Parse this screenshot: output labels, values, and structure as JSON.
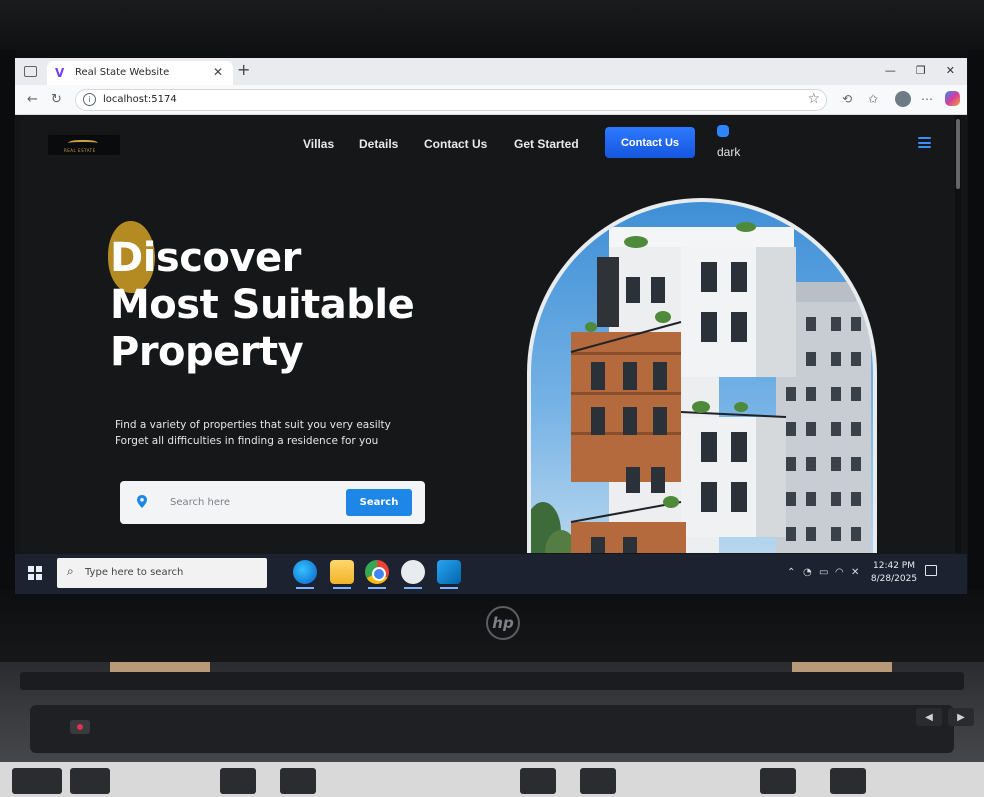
{
  "browser": {
    "tab_title": "Real State Website",
    "url": "localhost:5174",
    "window_controls": [
      "—",
      "❐",
      "✕"
    ]
  },
  "site": {
    "logo_text": "REAL ESTATE",
    "nav": {
      "links": [
        "Villas",
        "Details",
        "Contact Us",
        "Get Started"
      ],
      "cta": "Contact Us",
      "theme_label": "dark"
    },
    "hero": {
      "title": "Discover\nMost Suitable\nProperty",
      "subtitle": "Find a variety of properties that suit you very easilty\nForget all difficulties in finding a residence for you",
      "search_placeholder": "Search here",
      "search_button": "Search"
    }
  },
  "taskbar": {
    "search_placeholder": "Type here to search",
    "time": "12:42 PM",
    "date": "8/28/2025",
    "apps": [
      "edge-icon",
      "file-explorer-icon",
      "chrome-icon",
      "chatgpt-icon",
      "vscode-icon"
    ]
  },
  "device": {
    "brand": "hp"
  },
  "colors": {
    "accent_blue": "#1d86e6",
    "cta_blue": "#2d79ff",
    "gold_blob": "#b48a22",
    "site_bg": "#151718"
  }
}
